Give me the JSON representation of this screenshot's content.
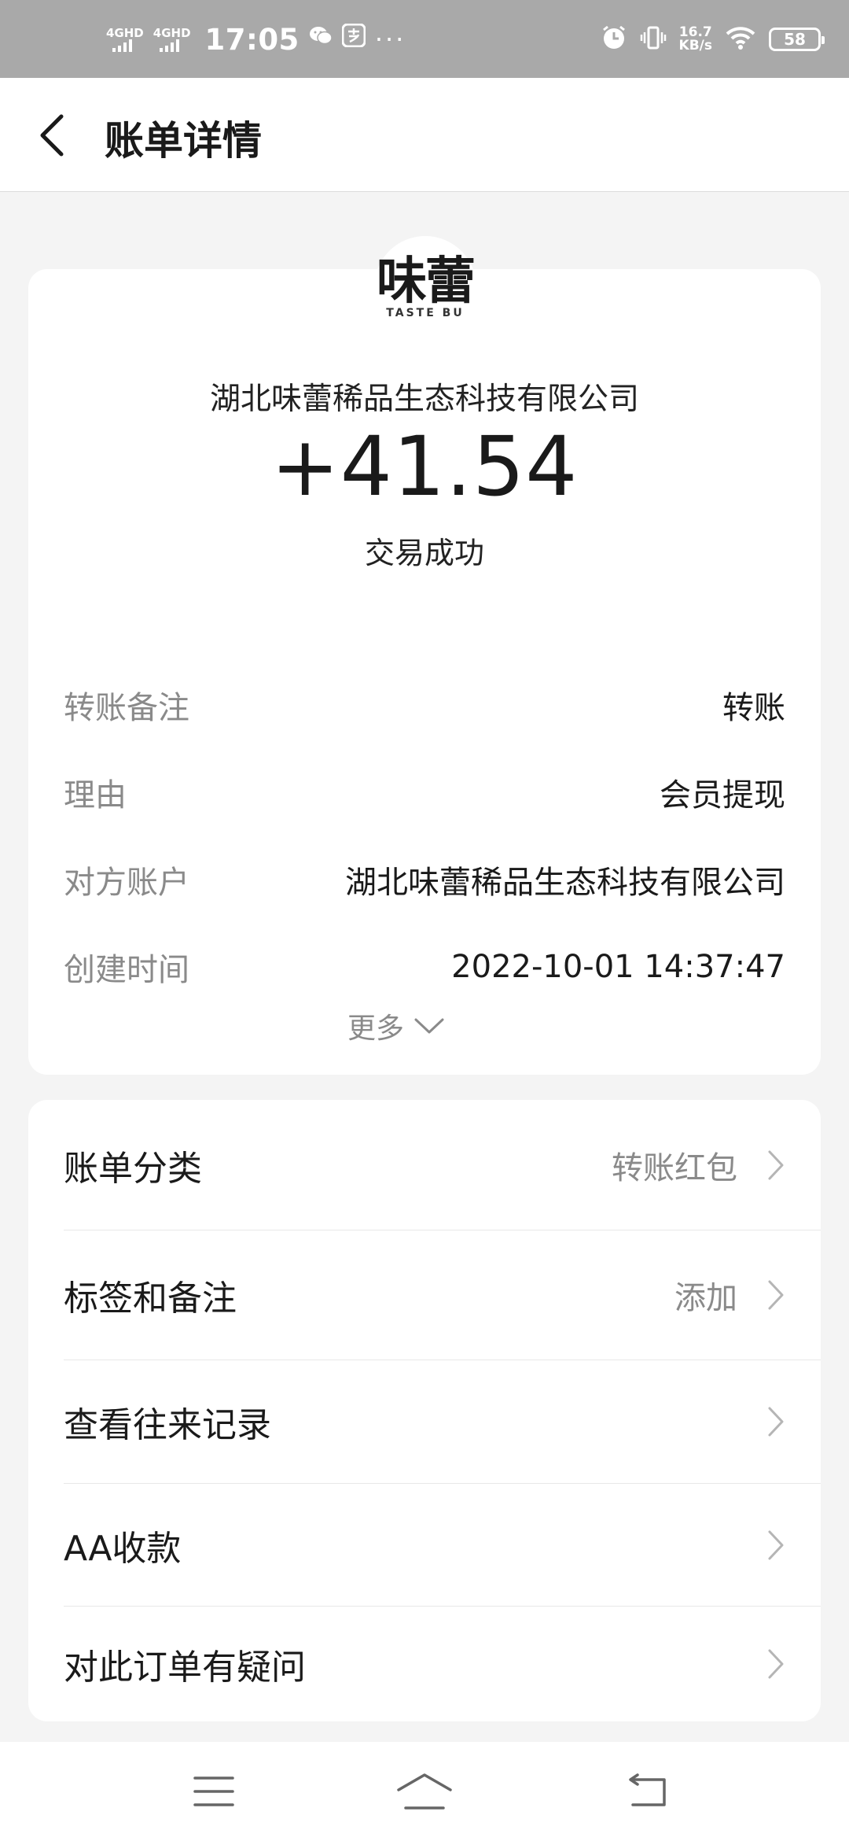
{
  "status_bar": {
    "signal1_label": "4GHD",
    "signal2_label": "4GHD",
    "time": "17:05",
    "wechat_icon": "wechat-icon",
    "alipay_icon": "alipay-icon",
    "more_dots": "···",
    "speed_value": "16.7",
    "speed_unit": "KB/s",
    "battery": "58"
  },
  "header": {
    "title": "账单详情"
  },
  "summary": {
    "logo_main": "味蕾",
    "logo_sub": "TASTE BU",
    "payee": "湖北味蕾稀品生态科技有限公司",
    "amount": "+41.54",
    "status": "交易成功"
  },
  "details": [
    {
      "label": "转账备注",
      "value": "转账"
    },
    {
      "label": "理由",
      "value": "会员提现"
    },
    {
      "label": "对方账户",
      "value": "湖北味蕾稀品生态科技有限公司"
    },
    {
      "label": "创建时间",
      "value": "2022-10-01 14:37:47"
    }
  ],
  "more_label": "更多",
  "menu": [
    {
      "label": "账单分类",
      "value": "转账红包"
    },
    {
      "label": "标签和备注",
      "value": "添加"
    },
    {
      "label": "查看往来记录",
      "value": ""
    },
    {
      "label": "AA收款",
      "value": ""
    },
    {
      "label": "对此订单有疑问",
      "value": ""
    }
  ],
  "colors": {
    "status_bar_bg": "#a9a9a9",
    "page_bg": "#f4f4f4",
    "card_bg": "#ffffff",
    "secondary_text": "#8a8a8a"
  }
}
